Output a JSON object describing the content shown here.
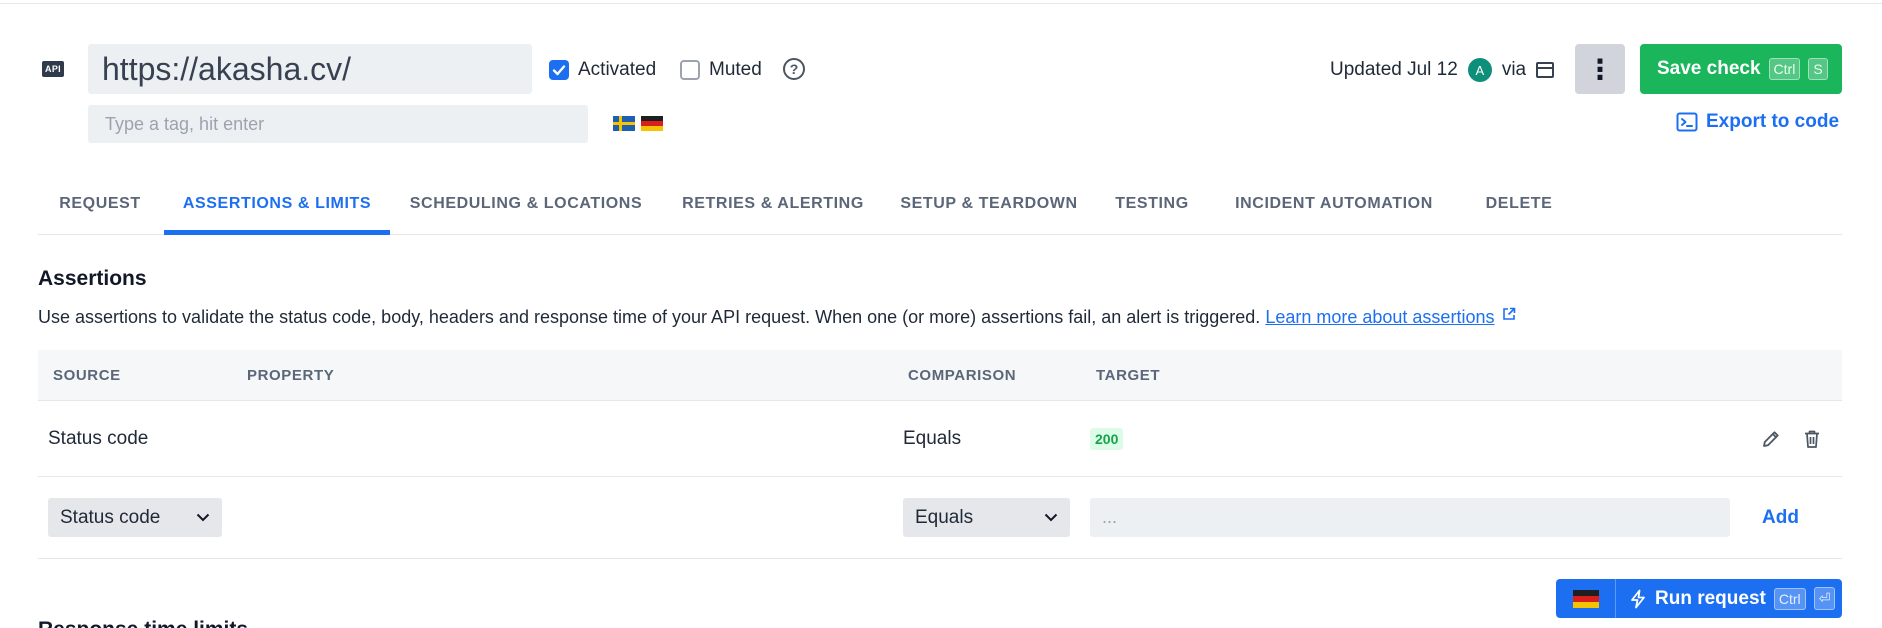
{
  "header": {
    "api_badge": "API",
    "url": "https://akasha.cv/",
    "activated_label": "Activated",
    "activated_checked": true,
    "muted_label": "Muted",
    "muted_checked": false,
    "help_glyph": "?",
    "tag_placeholder": "Type a tag, hit enter",
    "locations": [
      "flag-sweden",
      "flag-germany"
    ],
    "updated_text": "Updated Jul 12",
    "avatar_initial": "A",
    "via_text": "via",
    "via_icon": "calendar-icon",
    "more_glyph": "⋮",
    "save_label": "Save check",
    "save_kbd_1": "Ctrl",
    "save_kbd_2": "S",
    "export_label": "Export to code",
    "export_icon": "terminal-window-icon"
  },
  "tabs": [
    {
      "label": "REQUEST",
      "active": false
    },
    {
      "label": "ASSERTIONS & LIMITS",
      "active": true
    },
    {
      "label": "SCHEDULING & LOCATIONS",
      "active": false
    },
    {
      "label": "RETRIES & ALERTING",
      "active": false
    },
    {
      "label": "SETUP & TEARDOWN",
      "active": false
    },
    {
      "label": "TESTING",
      "active": false
    },
    {
      "label": "INCIDENT AUTOMATION",
      "active": false
    },
    {
      "label": "DELETE",
      "active": false
    }
  ],
  "assertions": {
    "title": "Assertions",
    "description": "Use assertions to validate the status code, body, headers and response time of your API request. When one (or more) assertions fail, an alert is triggered.",
    "learn_more": "Learn more about assertions",
    "columns": {
      "source": "SOURCE",
      "property": "PROPERTY",
      "comparison": "COMPARISON",
      "target": "TARGET"
    },
    "rows": [
      {
        "source": "Status code",
        "property": "",
        "comparison": "Equals",
        "target": "200"
      }
    ],
    "new_row": {
      "source_value": "Status code",
      "comparison_value": "Equals",
      "target_placeholder": "...",
      "add_label": "Add"
    }
  },
  "run_request": {
    "label": "Run request",
    "kbd_1": "Ctrl",
    "kbd_2": "⏎",
    "location": "flag-germany"
  },
  "next_section_title": "Response time limits",
  "colors": {
    "primary": "#1d6ff2",
    "success": "#1bb55c",
    "badge_green_bg": "#dcfce7",
    "badge_green_text": "#16a34a"
  }
}
